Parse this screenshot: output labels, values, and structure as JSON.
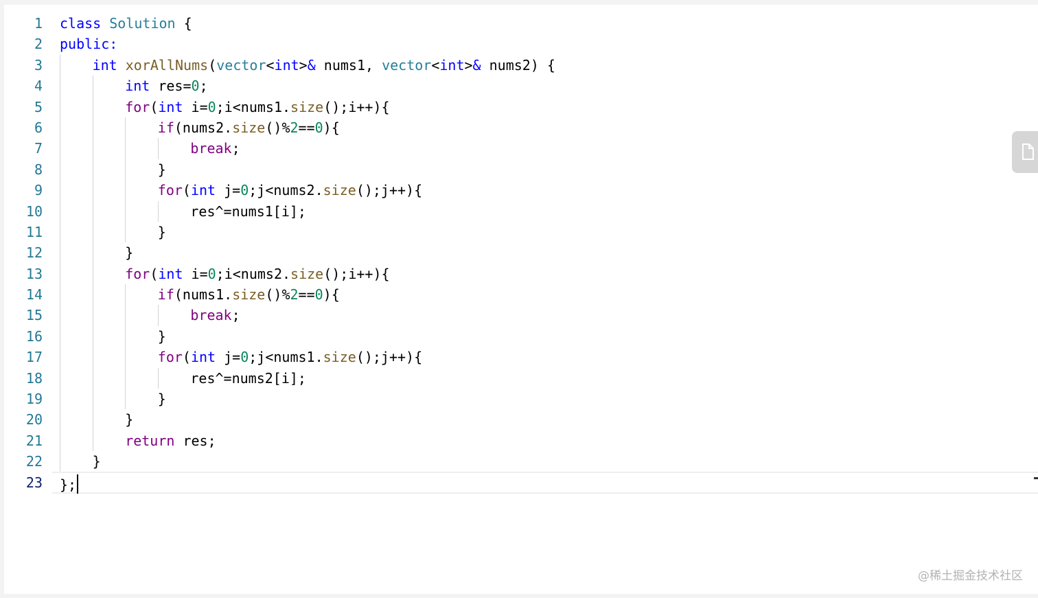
{
  "editor": {
    "current_line": 23,
    "lines": [
      {
        "num": "1",
        "indent": 0,
        "tokens": [
          {
            "t": "class",
            "c": "k"
          },
          {
            "t": " "
          },
          {
            "t": "Solution",
            "c": "t"
          },
          {
            "t": " {"
          }
        ]
      },
      {
        "num": "2",
        "indent": 0,
        "tokens": [
          {
            "t": "public:",
            "c": "k"
          }
        ]
      },
      {
        "num": "3",
        "indent": 1,
        "tokens": [
          {
            "t": "int",
            "c": "k"
          },
          {
            "t": " "
          },
          {
            "t": "xorAllNums",
            "c": "f"
          },
          {
            "t": "("
          },
          {
            "t": "vector",
            "c": "t"
          },
          {
            "t": "<"
          },
          {
            "t": "int",
            "c": "k"
          },
          {
            "t": ">"
          },
          {
            "t": "&",
            "c": "k"
          },
          {
            "t": " nums1, "
          },
          {
            "t": "vector",
            "c": "t"
          },
          {
            "t": "<"
          },
          {
            "t": "int",
            "c": "k"
          },
          {
            "t": ">"
          },
          {
            "t": "&",
            "c": "k"
          },
          {
            "t": " nums2) {"
          }
        ]
      },
      {
        "num": "4",
        "indent": 2,
        "tokens": [
          {
            "t": "int",
            "c": "k"
          },
          {
            "t": " res="
          },
          {
            "t": "0",
            "c": "n"
          },
          {
            "t": ";"
          }
        ]
      },
      {
        "num": "5",
        "indent": 2,
        "tokens": [
          {
            "t": "for",
            "c": "c"
          },
          {
            "t": "("
          },
          {
            "t": "int",
            "c": "k"
          },
          {
            "t": " i="
          },
          {
            "t": "0",
            "c": "n"
          },
          {
            "t": ";i<nums1."
          },
          {
            "t": "size",
            "c": "f"
          },
          {
            "t": "();i++){"
          }
        ]
      },
      {
        "num": "6",
        "indent": 3,
        "tokens": [
          {
            "t": "if",
            "c": "c"
          },
          {
            "t": "(nums2."
          },
          {
            "t": "size",
            "c": "f"
          },
          {
            "t": "()%"
          },
          {
            "t": "2",
            "c": "n"
          },
          {
            "t": "=="
          },
          {
            "t": "0",
            "c": "n"
          },
          {
            "t": "){"
          }
        ]
      },
      {
        "num": "7",
        "indent": 4,
        "tokens": [
          {
            "t": "break",
            "c": "c"
          },
          {
            "t": ";"
          }
        ]
      },
      {
        "num": "8",
        "indent": 3,
        "tokens": [
          {
            "t": "}"
          }
        ]
      },
      {
        "num": "9",
        "indent": 3,
        "tokens": [
          {
            "t": "for",
            "c": "c"
          },
          {
            "t": "("
          },
          {
            "t": "int",
            "c": "k"
          },
          {
            "t": " j="
          },
          {
            "t": "0",
            "c": "n"
          },
          {
            "t": ";j<nums2."
          },
          {
            "t": "size",
            "c": "f"
          },
          {
            "t": "();j++){"
          }
        ]
      },
      {
        "num": "10",
        "indent": 4,
        "tokens": [
          {
            "t": "res^=nums1[i];"
          }
        ]
      },
      {
        "num": "11",
        "indent": 3,
        "tokens": [
          {
            "t": "}"
          }
        ]
      },
      {
        "num": "12",
        "indent": 2,
        "tokens": [
          {
            "t": "}"
          }
        ]
      },
      {
        "num": "13",
        "indent": 2,
        "tokens": [
          {
            "t": "for",
            "c": "c"
          },
          {
            "t": "("
          },
          {
            "t": "int",
            "c": "k"
          },
          {
            "t": " i="
          },
          {
            "t": "0",
            "c": "n"
          },
          {
            "t": ";i<nums2."
          },
          {
            "t": "size",
            "c": "f"
          },
          {
            "t": "();i++){"
          }
        ]
      },
      {
        "num": "14",
        "indent": 3,
        "tokens": [
          {
            "t": "if",
            "c": "c"
          },
          {
            "t": "(nums1."
          },
          {
            "t": "size",
            "c": "f"
          },
          {
            "t": "()%"
          },
          {
            "t": "2",
            "c": "n"
          },
          {
            "t": "=="
          },
          {
            "t": "0",
            "c": "n"
          },
          {
            "t": "){"
          }
        ]
      },
      {
        "num": "15",
        "indent": 4,
        "tokens": [
          {
            "t": "break",
            "c": "c"
          },
          {
            "t": ";"
          }
        ]
      },
      {
        "num": "16",
        "indent": 3,
        "tokens": [
          {
            "t": "}"
          }
        ]
      },
      {
        "num": "17",
        "indent": 3,
        "tokens": [
          {
            "t": "for",
            "c": "c"
          },
          {
            "t": "("
          },
          {
            "t": "int",
            "c": "k"
          },
          {
            "t": " j="
          },
          {
            "t": "0",
            "c": "n"
          },
          {
            "t": ";j<nums1."
          },
          {
            "t": "size",
            "c": "f"
          },
          {
            "t": "();j++){"
          }
        ]
      },
      {
        "num": "18",
        "indent": 4,
        "tokens": [
          {
            "t": "res^=nums2[i];"
          }
        ]
      },
      {
        "num": "19",
        "indent": 3,
        "tokens": [
          {
            "t": "}"
          }
        ]
      },
      {
        "num": "20",
        "indent": 2,
        "tokens": [
          {
            "t": "}"
          }
        ]
      },
      {
        "num": "21",
        "indent": 2,
        "tokens": [
          {
            "t": "return",
            "c": "c"
          },
          {
            "t": " res;"
          }
        ]
      },
      {
        "num": "22",
        "indent": 1,
        "tokens": [
          {
            "t": "}"
          }
        ]
      },
      {
        "num": "23",
        "indent": 0,
        "tokens": [
          {
            "t": "};"
          }
        ]
      }
    ]
  },
  "side_tab": {
    "icon": "document-icon"
  },
  "watermark": "@稀土掘金技术社区"
}
